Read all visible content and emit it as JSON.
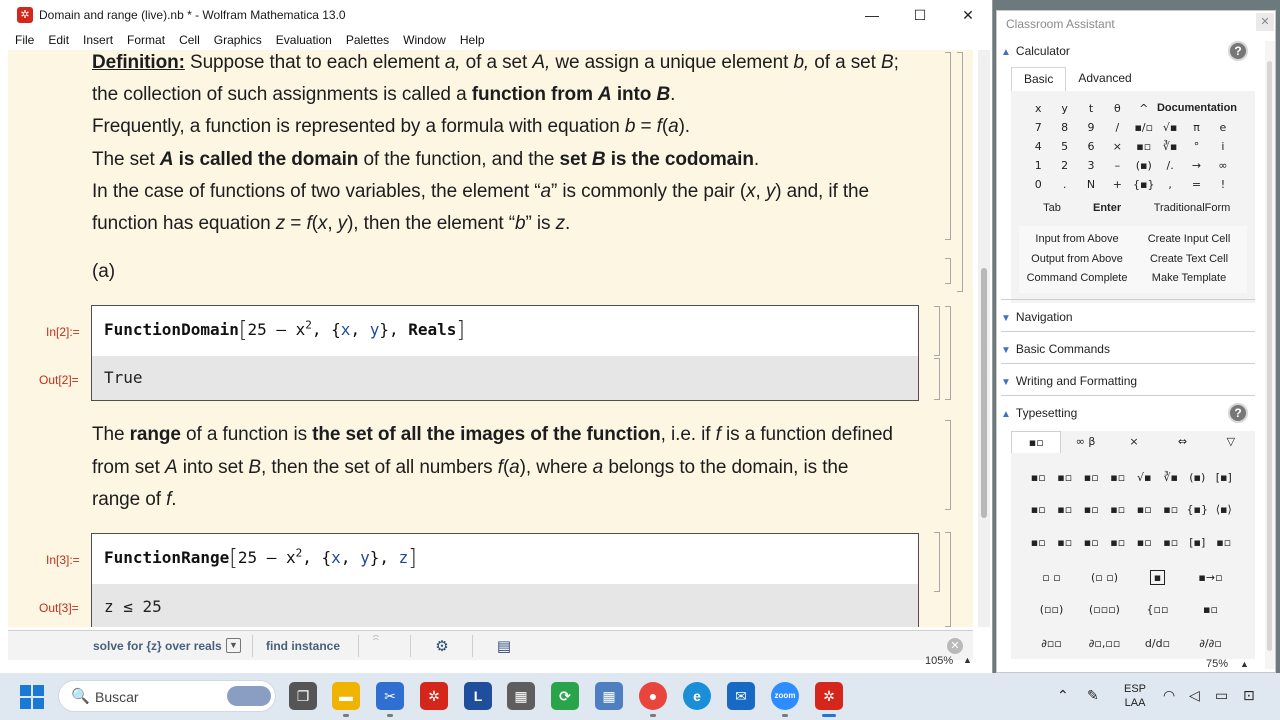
{
  "window": {
    "title": "Domain and range (live).nb * - Wolfram Mathematica 13.0",
    "logo_glyph": "✲",
    "minimize": "—",
    "maximize": "☐",
    "close": "✕"
  },
  "menu": [
    "File",
    "Edit",
    "Insert",
    "Format",
    "Cell",
    "Graphics",
    "Evaluation",
    "Palettes",
    "Window",
    "Help"
  ],
  "notebook": {
    "definition": {
      "l1_label": "Definition:",
      "l1_a": " Suppose that to each element ",
      "l1_a_var": "a,",
      "l1_b": " of a set ",
      "l1_b_var": "A,",
      "l1_c": " we assign a unique element ",
      "l1_c_var": "b,",
      "l1_d": " of a set ",
      "l1_d_var": "B",
      "l1_e": ";",
      "l2_a": "the collection of such assignments is called a ",
      "l2_bold": "function from ",
      "l2_bold_var1": "A",
      "l2_bold_mid": " into ",
      "l2_bold_var2": "B",
      "l2_end": ".",
      "l3_a": "Frequently, a function is represented by a formula with equation ",
      "l3_eq_b": "b",
      "l3_eq_mid": " = ",
      "l3_eq_f": "f",
      "l3_eq_paren_open": "(",
      "l3_eq_a": "a",
      "l3_eq_paren_close": ").",
      "l4_a": "The set ",
      "l4_var_a": "A",
      "l4_bold1": " is called the domain",
      "l4_mid": " of the function, and the ",
      "l4_bold2a": "set ",
      "l4_var_b": "B",
      "l4_bold2b": " is the codomain",
      "l4_end": ".",
      "l5_a": "In the case of functions of two variables, the element “",
      "l5_var": "a",
      "l5_b": "” is commonly the pair (",
      "l5_x": "x",
      "l5_comma": ", ",
      "l5_y": "y",
      "l5_c": ") and, if the",
      "l6_a": "function has equation ",
      "l6_z": "z",
      "l6_eq": " = ",
      "l6_f": "f",
      "l6_open": "(",
      "l6_x": "x",
      "l6_comma": ", ",
      "l6_y": "y",
      "l6_b": "), then the element “",
      "l6_bvar": "b",
      "l6_c": "” is ",
      "l6_zend": "z",
      "l6_end": "."
    },
    "part_label": "(a)",
    "cell2": {
      "in_label": "In[2]:=",
      "out_label": "Out[2]=",
      "fn": "FunctionDomain",
      "lb": "[",
      "arg1": "25",
      "minus": " – ",
      "xvar": "x",
      "exp": "2",
      "comma1": ", {",
      "x2": "x",
      "comma2": ", ",
      "y2": "y",
      "close_set": "}, ",
      "last": "Reals",
      "rb": "]",
      "output": "True"
    },
    "range": {
      "l1_a": "The ",
      "l1_bold1": "range",
      "l1_b": " of a function is ",
      "l1_bold2": "the set of all the images of the function",
      "l1_c": ", i.e. if ",
      "l1_f": "f",
      "l1_d": " is a function defined",
      "l2_a": "from set ",
      "l2_A": "A",
      "l2_b": " into set ",
      "l2_B": "B",
      "l2_c": ", then the set of all numbers ",
      "l2_f": "f",
      "l2_open": "(",
      "l2_a2": "a",
      "l2_close": ")",
      "l2_d": ", where ",
      "l2_a3": "a",
      "l2_e": " belongs to the domain, is the",
      "l3_a": "range of ",
      "l3_f": "f",
      "l3_end": "."
    },
    "cell3": {
      "in_label": "In[3]:=",
      "out_label": "Out[3]=",
      "fn": "FunctionRange",
      "lb": "[",
      "arg1": "25",
      "minus": " – ",
      "xvar": "x",
      "exp": "2",
      "comma1": ", {",
      "x2": "x",
      "comma2": ", ",
      "y2": "y",
      "close_set": "}, ",
      "last": "z",
      "rb": "]",
      "output": "z ≤ 25"
    }
  },
  "suggestions": {
    "solve": "solve for {z} over reals",
    "find": "find instance",
    "close_glyph": "✕"
  },
  "zoom": "105%",
  "palette": {
    "title": "Classroom Assistant",
    "close_glyph": "✕",
    "calculator": "Calculator",
    "help": "?",
    "tabs": [
      "Basic",
      "Advanced"
    ],
    "keys": [
      "x",
      "y",
      "t",
      "θ",
      "^",
      "Documentation",
      "7",
      "8",
      "9",
      "/",
      "▪/▫",
      "√▪",
      "π",
      "e",
      "4",
      "5",
      "6",
      "×",
      "▪▫",
      "∛▪",
      "°",
      "i",
      "1",
      "2",
      "3",
      "–",
      "(▪)",
      "/.",
      "→",
      "∞",
      "0",
      ".",
      "N",
      "+",
      "{▪}",
      ",",
      "=",
      "!"
    ],
    "row_tab": "Tab",
    "row_enter": "Enter",
    "row_tf": "TraditionalForm",
    "buttons": [
      "Input from Above",
      "Create Input Cell",
      "Output from Above",
      "Create Text Cell",
      "Command Complete",
      "Make Template"
    ],
    "navigation": "Navigation",
    "basic_commands": "Basic Commands",
    "writing": "Writing and Formatting",
    "typesetting": "Typesetting",
    "ts_tabs": [
      "▪▫",
      "∞ β",
      "×",
      "⇔",
      "▽"
    ],
    "ts_keys": [
      "▪▫",
      "▪▫",
      "▪▫",
      "▪▫",
      "√▪",
      "∛▪",
      "(▪)",
      "[▪]",
      "▪▫",
      "▪▫",
      "▪▫",
      "▪▫",
      "▪▫",
      "▪▫",
      "{▪}",
      "⟨▪⟩",
      "▪▫",
      "▪▫",
      "▪▫",
      "▪▫",
      "▪▫",
      "▪▫",
      "[▪]",
      "▪▫"
    ],
    "ts_row4": [
      "▫ ▫",
      "(▫ ▫)",
      "▪",
      "▪→▫"
    ],
    "ts_row5": [
      "(▫▫)",
      "(▫▫▫)",
      "{▫▫",
      "▪▫"
    ],
    "ts_row6": [
      "∂▫▫",
      "∂▫,▫▫",
      "d/d▫",
      "∂/∂▫"
    ],
    "zoom": "75%"
  },
  "taskbar": {
    "search_icon": "🔍",
    "search_text": "Buscar",
    "lang_top": "ESP",
    "lang_bottom": "LAA",
    "apps": [
      "file-explorer",
      "snipping-tool",
      "mathematica",
      "L-app",
      "calculator",
      "sync",
      "grid-calc",
      "chrome",
      "edge",
      "mail",
      "zoom",
      "mathematica-active"
    ]
  },
  "colors": {
    "notebook_bg": "#fcf6e3",
    "cell_label": "#c12e1b",
    "var_blue": "#1c4a9c",
    "accent": "#3d72c7"
  }
}
